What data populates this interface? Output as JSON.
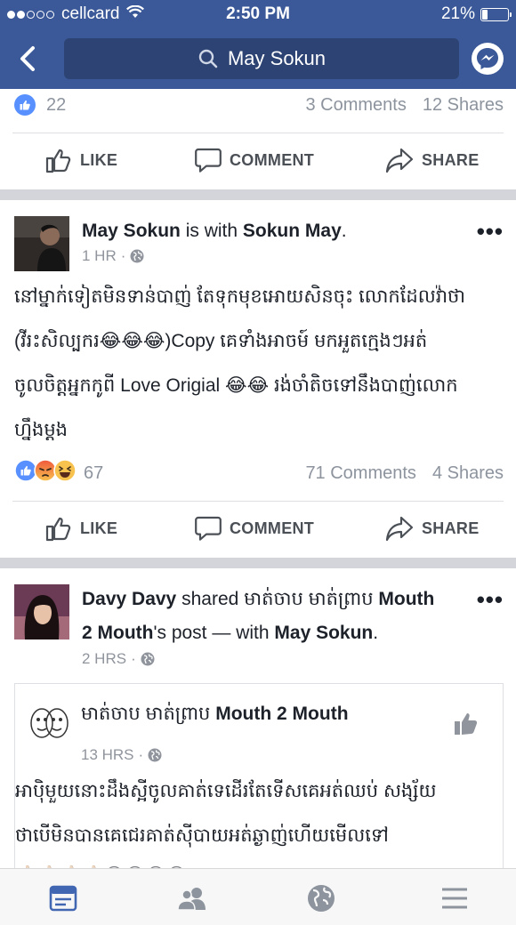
{
  "status_bar": {
    "carrier": "cellcard",
    "time": "2:50 PM",
    "battery": "21%",
    "battery_level": 0.21
  },
  "nav": {
    "search_text": "May Sokun",
    "back_icon": "chevron-left-icon",
    "messenger_icon": "messenger-icon",
    "search_icon": "search-icon"
  },
  "colors": {
    "brand": "#3b5998",
    "search_bg": "#2d4373",
    "like_blue": "#5890ff",
    "active_tab": "#4267b2"
  },
  "feed": {
    "prev_post": {
      "reaction_count": "22",
      "comments": "3 Comments",
      "shares": "12 Shares"
    },
    "actions": {
      "like": "LIKE",
      "comment": "COMMENT",
      "share": "SHARE"
    },
    "post1": {
      "author": "May Sokun",
      "with_text": "is with",
      "tagged": "Sokun May",
      "period": ".",
      "time": "1 HR",
      "dot": "·",
      "text_lines": [
        "នៅម្នាក់ទៀតមិនទាន់បាញ់ តែទុកមុខអោយសិនចុះ លោកដែលវ៉ាថា",
        "(វីរះសិល្បករ😂😂😂)Copy គេទាំងអាចម៍ មកអួតក្មេងៗអត់",
        "ចូលចិត្តអ្នកកូពី Love Origial 😂😂 រង់ចាំតិចទៅនឹងបាញ់លោក",
        "ហ្នឹងម្តង"
      ],
      "reaction_count": "67",
      "comments": "71 Comments",
      "shares": "4 Shares"
    },
    "post2": {
      "author": "Davy Davy",
      "shared_text": "shared",
      "page_name": "មាត់ចាប មាត់ព្រាប",
      "page_name_bold": "Mouth",
      "line2_bold": "2 Mouth",
      "line2_rest": "'s post — with",
      "tagged": "May Sokun",
      "period": ".",
      "time": "2 HRS",
      "dot": "·",
      "shared_post": {
        "author_kh": "មាត់ចាប មាត់ព្រាប",
        "author_en": "Mouth 2 Mouth",
        "time": "13 HRS",
        "dot": "·",
        "text_lines": [
          "អាប៉ិមួយនោះដឹងស្អីចូលគាត់ទេដើរតែទើសគេអត់ឈប់ សង្ស័យ",
          "ថាបើមិនបានគេជេរគាត់ស៊ីបាយអត់ឆ្ងាញ់ហើយមើលទៅ"
        ],
        "emoji_row": "👍🏼👍🏼👍🏼👍🏼😂😂😂😂"
      }
    }
  },
  "tabbar": {
    "tabs": [
      "news-feed-icon",
      "friends-icon",
      "globe-icon",
      "menu-icon"
    ]
  }
}
